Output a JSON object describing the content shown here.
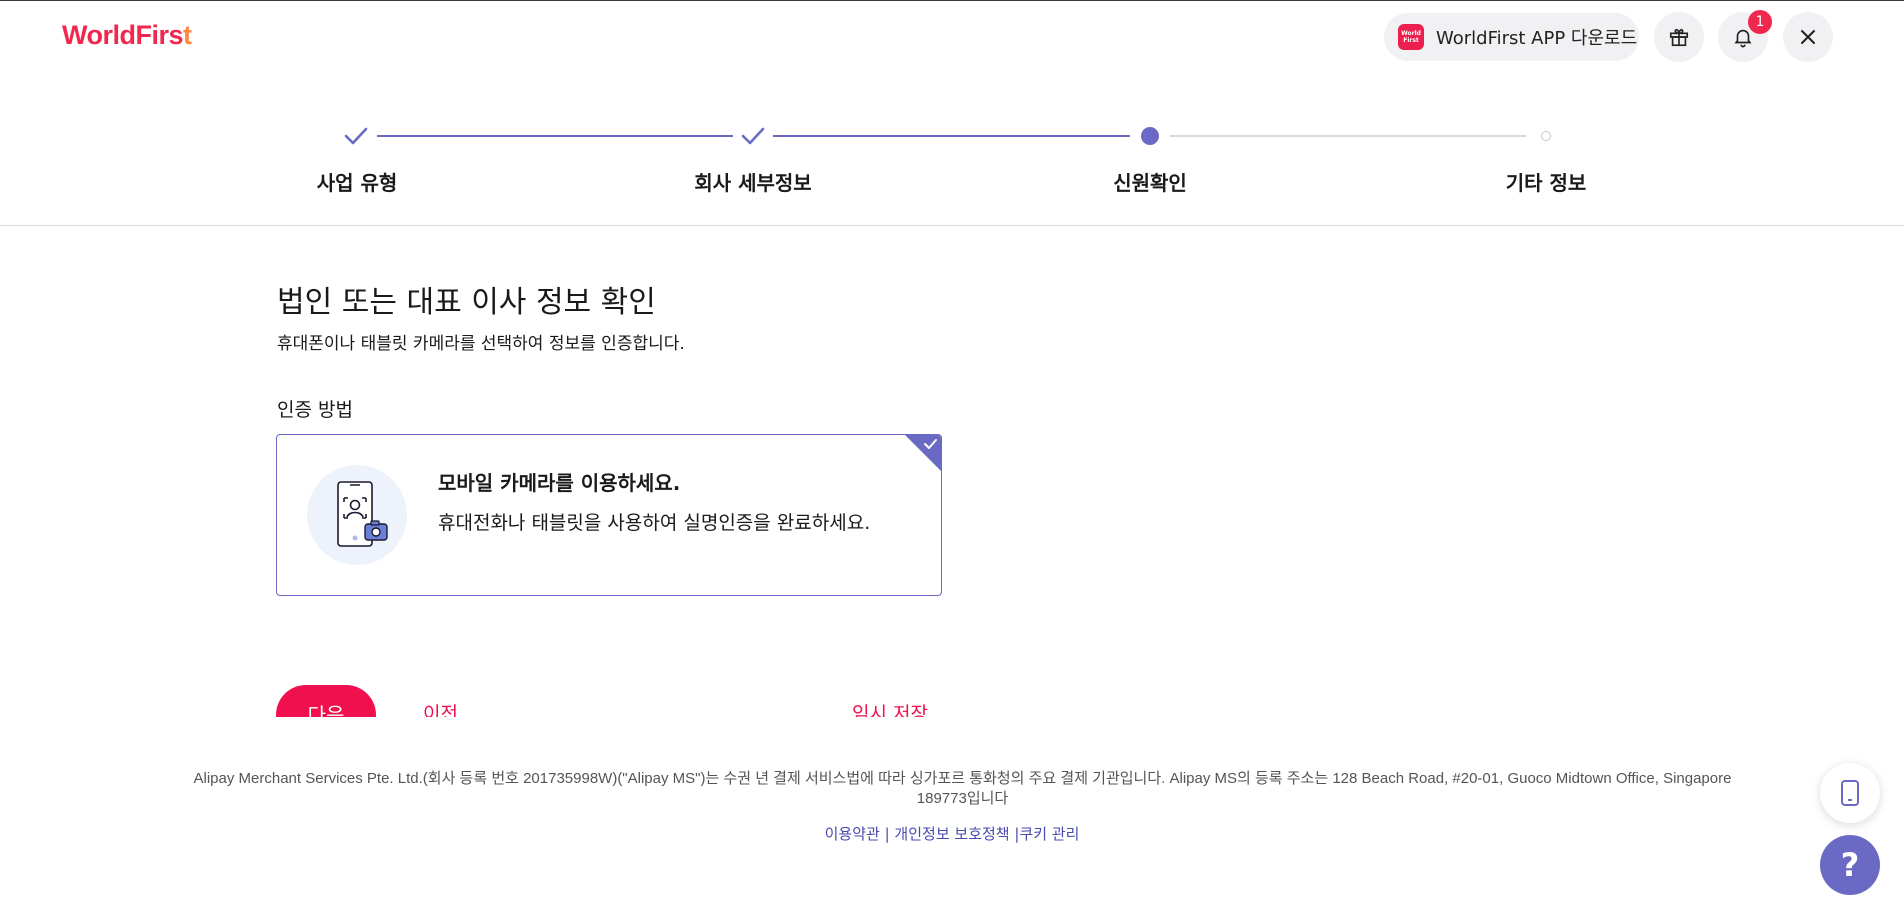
{
  "header": {
    "logo_text": "WorldFirs",
    "logo_flare": "t",
    "app_download_label": "WorldFirst APP 다운로드",
    "app_icon_line1": "World",
    "app_icon_line2": "First",
    "notification_count": "1"
  },
  "stepper": {
    "steps": [
      {
        "label": "사업 유형",
        "state": "done"
      },
      {
        "label": "회사 세부정보",
        "state": "done"
      },
      {
        "label": "신원확인",
        "state": "current"
      },
      {
        "label": "기타 정보",
        "state": "todo"
      }
    ]
  },
  "main": {
    "title": "법인 또는 대표 이사 정보 확인",
    "subtitle": "휴대폰이나 태블릿 카메라를 선택하여 정보를 인증합니다.",
    "method_label": "인증 방법",
    "option": {
      "title": "모바일 카메라를 이용하세요.",
      "description": "휴대전화나 태블릿을 사용하여 실명인증을 완료하세요.",
      "selected": true
    }
  },
  "actions": {
    "next_label": "다음",
    "prev_label": "이전",
    "save_label": "임시 저장"
  },
  "footer": {
    "legal_text": "Alipay Merchant Services Pte. Ltd.(회사 등록 번호 201735998W)(\"Alipay MS\")는 수권 년 결제 서비스법에 따라 싱가포르 통화청의 주요 결제 기관입니다. Alipay MS의 등록 주소는 128 Beach Road, #20-01, Guoco Midtown Office, Singapore 189773입니다",
    "links": [
      "이용약관",
      "개인정보 보호정책",
      "쿠키 관리"
    ],
    "separator": "|"
  },
  "floating": {
    "help_label": "?"
  },
  "colors": {
    "brand": "#f0274f",
    "accent": "#6a6ac4",
    "cta": "#f0104d"
  }
}
